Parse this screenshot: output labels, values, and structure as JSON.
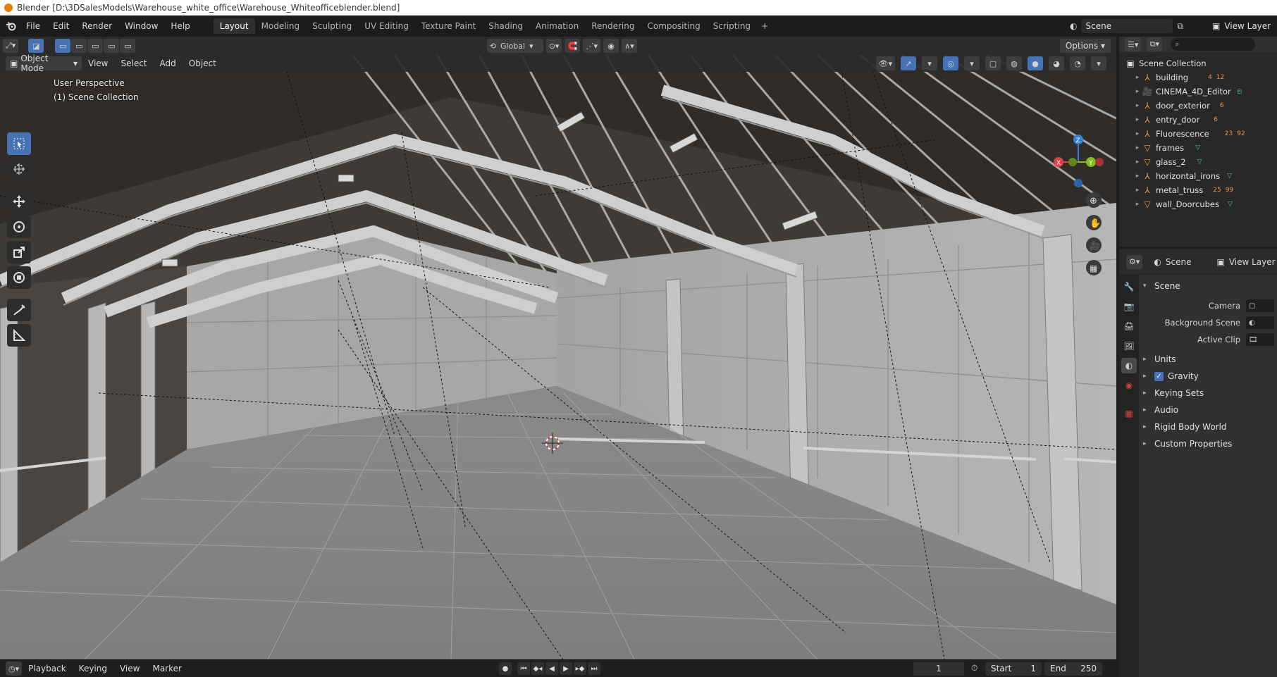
{
  "window": {
    "title": "Blender [D:\\3DSalesModels\\Warehouse_white_office\\Warehouse_Whiteofficeblender.blend]"
  },
  "menubar": {
    "items": [
      "File",
      "Edit",
      "Render",
      "Window",
      "Help"
    ]
  },
  "workspaces": {
    "tabs": [
      "Layout",
      "Modeling",
      "Sculpting",
      "UV Editing",
      "Texture Paint",
      "Shading",
      "Animation",
      "Rendering",
      "Compositing",
      "Scripting"
    ],
    "active": "Layout",
    "add_label": "+"
  },
  "scene_selector": {
    "value": "Scene"
  },
  "view_layer_selector": {
    "value": "View Layer"
  },
  "viewport_header": {
    "transform_orientation": "Global",
    "options_label": "Options"
  },
  "viewport_header2": {
    "mode": "Object Mode",
    "menus": [
      "View",
      "Select",
      "Add",
      "Object"
    ]
  },
  "viewport": {
    "perspective_label": "User Perspective",
    "collection_label": "(1) Scene Collection",
    "accent_color": "#4772b3"
  },
  "toolbar": {
    "tools": [
      "select-box",
      "cursor",
      "move",
      "rotate",
      "scale",
      "transform",
      "annotate",
      "measure"
    ],
    "active": "select-box"
  },
  "gizmo": {
    "axes": [
      "X",
      "Y",
      "Z"
    ],
    "colors": {
      "x": "#e0424a",
      "y": "#7fbc1c",
      "z": "#3a7fd6"
    }
  },
  "timeline": {
    "menus": [
      "Playback",
      "Keying",
      "View",
      "Marker"
    ],
    "current_frame": "1",
    "start_label": "Start",
    "start_value": "1",
    "end_label": "End",
    "end_value": "250"
  },
  "outliner": {
    "root": "Scene Collection",
    "items": [
      {
        "name": "building",
        "icon": "empty",
        "extra": [
          "4",
          "12"
        ]
      },
      {
        "name": "CINEMA_4D_Editor",
        "icon": "camera",
        "extra": []
      },
      {
        "name": "door_exterior",
        "icon": "empty",
        "extra": [
          "6"
        ]
      },
      {
        "name": "entry_door",
        "icon": "empty",
        "extra": [
          "6"
        ]
      },
      {
        "name": "Fluorescence",
        "icon": "empty",
        "extra": [
          "23",
          "92"
        ]
      },
      {
        "name": "frames",
        "icon": "mesh",
        "extra": []
      },
      {
        "name": "glass_2",
        "icon": "mesh",
        "extra": []
      },
      {
        "name": "horizontal_irons",
        "icon": "empty",
        "extra": []
      },
      {
        "name": "metal_truss",
        "icon": "empty",
        "extra": [
          "25",
          "99"
        ]
      },
      {
        "name": "wall_Doorcubes",
        "icon": "mesh",
        "extra": []
      }
    ]
  },
  "properties": {
    "header_scene": "Scene",
    "header_view_layer": "View Layer",
    "panel_title": "Scene",
    "fields": [
      {
        "label": "Camera"
      },
      {
        "label": "Background Scene"
      },
      {
        "label": "Active Clip"
      }
    ],
    "sections": [
      "Units",
      "Gravity",
      "Keying Sets",
      "Audio",
      "Rigid Body World",
      "Custom Properties"
    ],
    "gravity_checked": true
  }
}
